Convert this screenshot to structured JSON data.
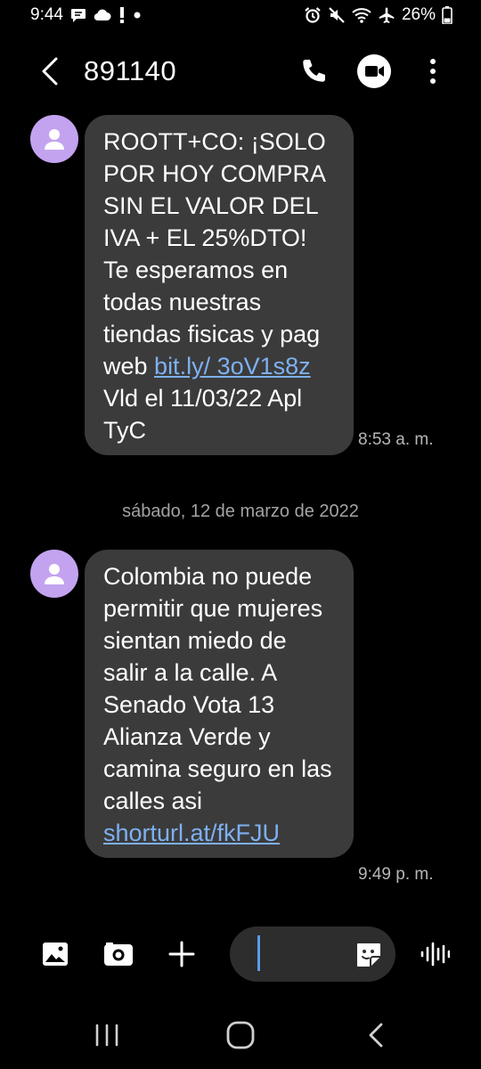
{
  "status": {
    "time": "9:44",
    "battery": "26%",
    "left_icons": [
      "chat-notification-icon",
      "cloud-icon",
      "exclamation-icon",
      "dot-icon"
    ],
    "right_icons": [
      "alarm-icon",
      "mute-icon",
      "wifi-icon",
      "airplane-icon",
      "battery-icon"
    ]
  },
  "header": {
    "title": "891140"
  },
  "messages": [
    {
      "text": "ROOTT+CO: ¡SOLO POR HOY COMPRA SIN EL VALOR DEL IVA + EL 25%DTO! Te esperamos en todas nuestras tiendas fisicas y pag web",
      "link_1": "bit.ly/",
      "link_2": "3oV1s8z",
      "tail": "Vld el 11/03/22 Apl TyC",
      "time": "8:53 a. m."
    },
    {
      "text": "Colombia no puede permitir que mujeres sientan miedo de salir a la calle. A Senado Vota 13 Alianza Verde y camina seguro en las calles asi",
      "link": "shorturl.at/fkFJU",
      "time": "9:49 p. m."
    }
  ],
  "date_separator": "sábado, 12 de marzo de 2022",
  "colors": {
    "background": "#000000",
    "bubble": "#3b3b3b",
    "avatar": "#c3a3f0",
    "link": "#7eb1f2",
    "caret": "#5b9ae8"
  }
}
